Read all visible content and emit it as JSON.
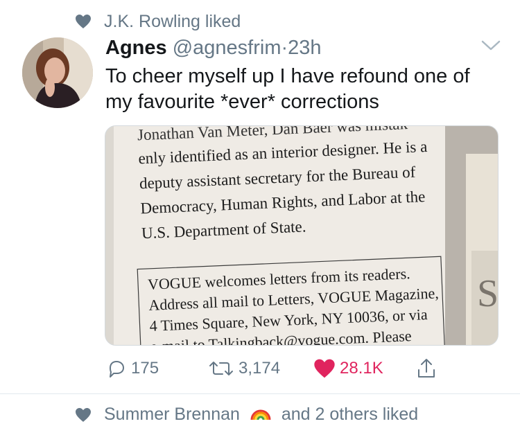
{
  "context": {
    "icon": "heart-icon",
    "text": "J.K. Rowling liked"
  },
  "tweet": {
    "author_name": "Agnes",
    "handle": "@agnesfrim",
    "separator": "·",
    "time": "23h",
    "text_line1": "To cheer myself up I have refound one of",
    "text_line2": "my favourite *ever* corrections"
  },
  "photo": {
    "top_fragment": "Jonathan Van Meter, Dan Baer was mistak-",
    "correction_lines": [
      "enly identified as an interior designer. He is a",
      "deputy assistant secretary for the Bureau of",
      "Democracy, Human Rights, and Labor at the",
      "U.S. Department of State."
    ],
    "box_lines": [
      "VOGUE welcomes letters from its readers.",
      "Address all mail to Letters, VOGUE Magazine,",
      "4 Times Square, New York, NY 10036, or via",
      "e-mail to Talkingback@vogue.com. Please"
    ],
    "page_edge_letter": "S"
  },
  "actions": {
    "reply_count": "175",
    "retweet_count": "3,174",
    "like_count": "28.1K",
    "accent_like": "#e0245e",
    "muted": "#657786"
  },
  "next_tweet": {
    "context_name": "Summer Brennan",
    "context_suffix": "and 2 others liked",
    "icon": "rainbow-emoji"
  }
}
